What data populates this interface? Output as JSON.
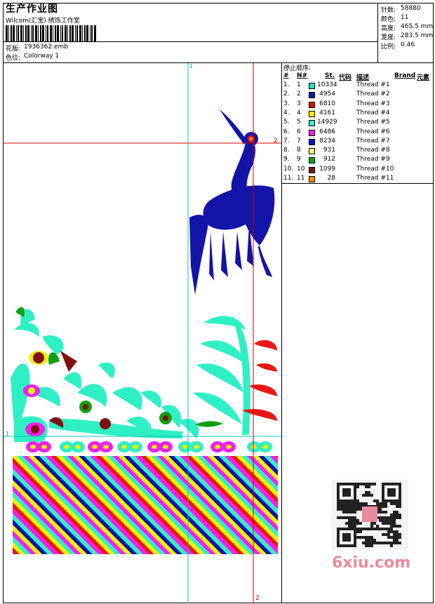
{
  "header": {
    "title": "生产作业图",
    "studio": "Wilcom(汇宝) 绣饰工作室",
    "design_label": "花版:",
    "design_value": "1936362.emb",
    "colorway_label": "色位:",
    "colorway_value": "Colorway 1"
  },
  "stats": [
    {
      "label": "针数:",
      "value": "58880"
    },
    {
      "label": "颜色:",
      "value": "11"
    },
    {
      "label": "高度:",
      "value": "465.5 mm"
    },
    {
      "label": "宽度:",
      "value": "283.5 mm"
    },
    {
      "label": "比例:",
      "value": "0.46"
    }
  ],
  "stop_sequence": {
    "title": "停止顺序:",
    "columns": [
      "#",
      "N#",
      "St.",
      "代码",
      "描述",
      "Brand",
      "元素"
    ],
    "rows": [
      {
        "idx": "1.",
        "n": "1",
        "color": "#22e0b8",
        "st": "10334",
        "desc": "Thread #1"
      },
      {
        "idx": "2.",
        "n": "2",
        "color": "#1a1aa8",
        "st": "4954",
        "desc": "Thread #2"
      },
      {
        "idx": "3.",
        "n": "3",
        "color": "#e01010",
        "st": "6810",
        "desc": "Thread #3"
      },
      {
        "idx": "4.",
        "n": "4",
        "color": "#f0f000",
        "st": "4161",
        "desc": "Thread #4"
      },
      {
        "idx": "5.",
        "n": "5",
        "color": "#30f0c8",
        "st": "14929",
        "desc": "Thread #5"
      },
      {
        "idx": "6.",
        "n": "6",
        "color": "#f020f0",
        "st": "6486",
        "desc": "Thread #6"
      },
      {
        "idx": "7.",
        "n": "7",
        "color": "#1010c0",
        "st": "8234",
        "desc": "Thread #7"
      },
      {
        "idx": "8.",
        "n": "8",
        "color": "#f8f080",
        "st": "931",
        "desc": "Thread #8"
      },
      {
        "idx": "9.",
        "n": "9",
        "color": "#10a010",
        "st": "912",
        "desc": "Thread #9"
      },
      {
        "idx": "10.",
        "n": "10",
        "color": "#801010",
        "st": "1099",
        "desc": "Thread #10"
      },
      {
        "idx": "11.",
        "n": "11",
        "color": "#f09010",
        "st": "28",
        "desc": "Thread #11"
      }
    ]
  },
  "markers": {
    "v1": "1",
    "v2": "2",
    "h1": "1",
    "h2": "2"
  },
  "watermark": "6xiu.com",
  "colors": {
    "teal": "#2ff0c4",
    "navy": "#1414a8",
    "red": "#e81818",
    "yellow": "#f0f000",
    "magenta": "#f020f0",
    "green": "#10a010",
    "maroon": "#801010",
    "cyan_guide": "#00c8b4",
    "red_guide": "#d00000"
  }
}
